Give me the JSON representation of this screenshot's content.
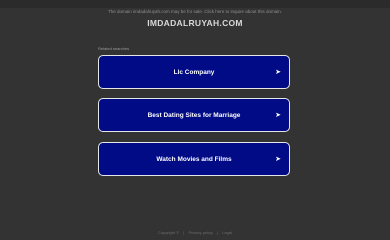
{
  "topbar": {
    "notice": "The domain imdadalruyah.com may be for sale. Click here to inquire about this domain."
  },
  "domain": {
    "title": "IMDADALRUYAH.COM"
  },
  "related": {
    "label": "Related searches",
    "links": [
      {
        "label": "Llc Company",
        "arrow": "➤"
      },
      {
        "label": "Best Dating Sites for Marriage",
        "arrow": "➤"
      },
      {
        "label": "Watch Movies and Films",
        "arrow": "➤"
      }
    ]
  },
  "footer": {
    "copyright": "Copyright ©",
    "separator": "|",
    "privacy": "Privacy policy",
    "legal": "Legal"
  }
}
